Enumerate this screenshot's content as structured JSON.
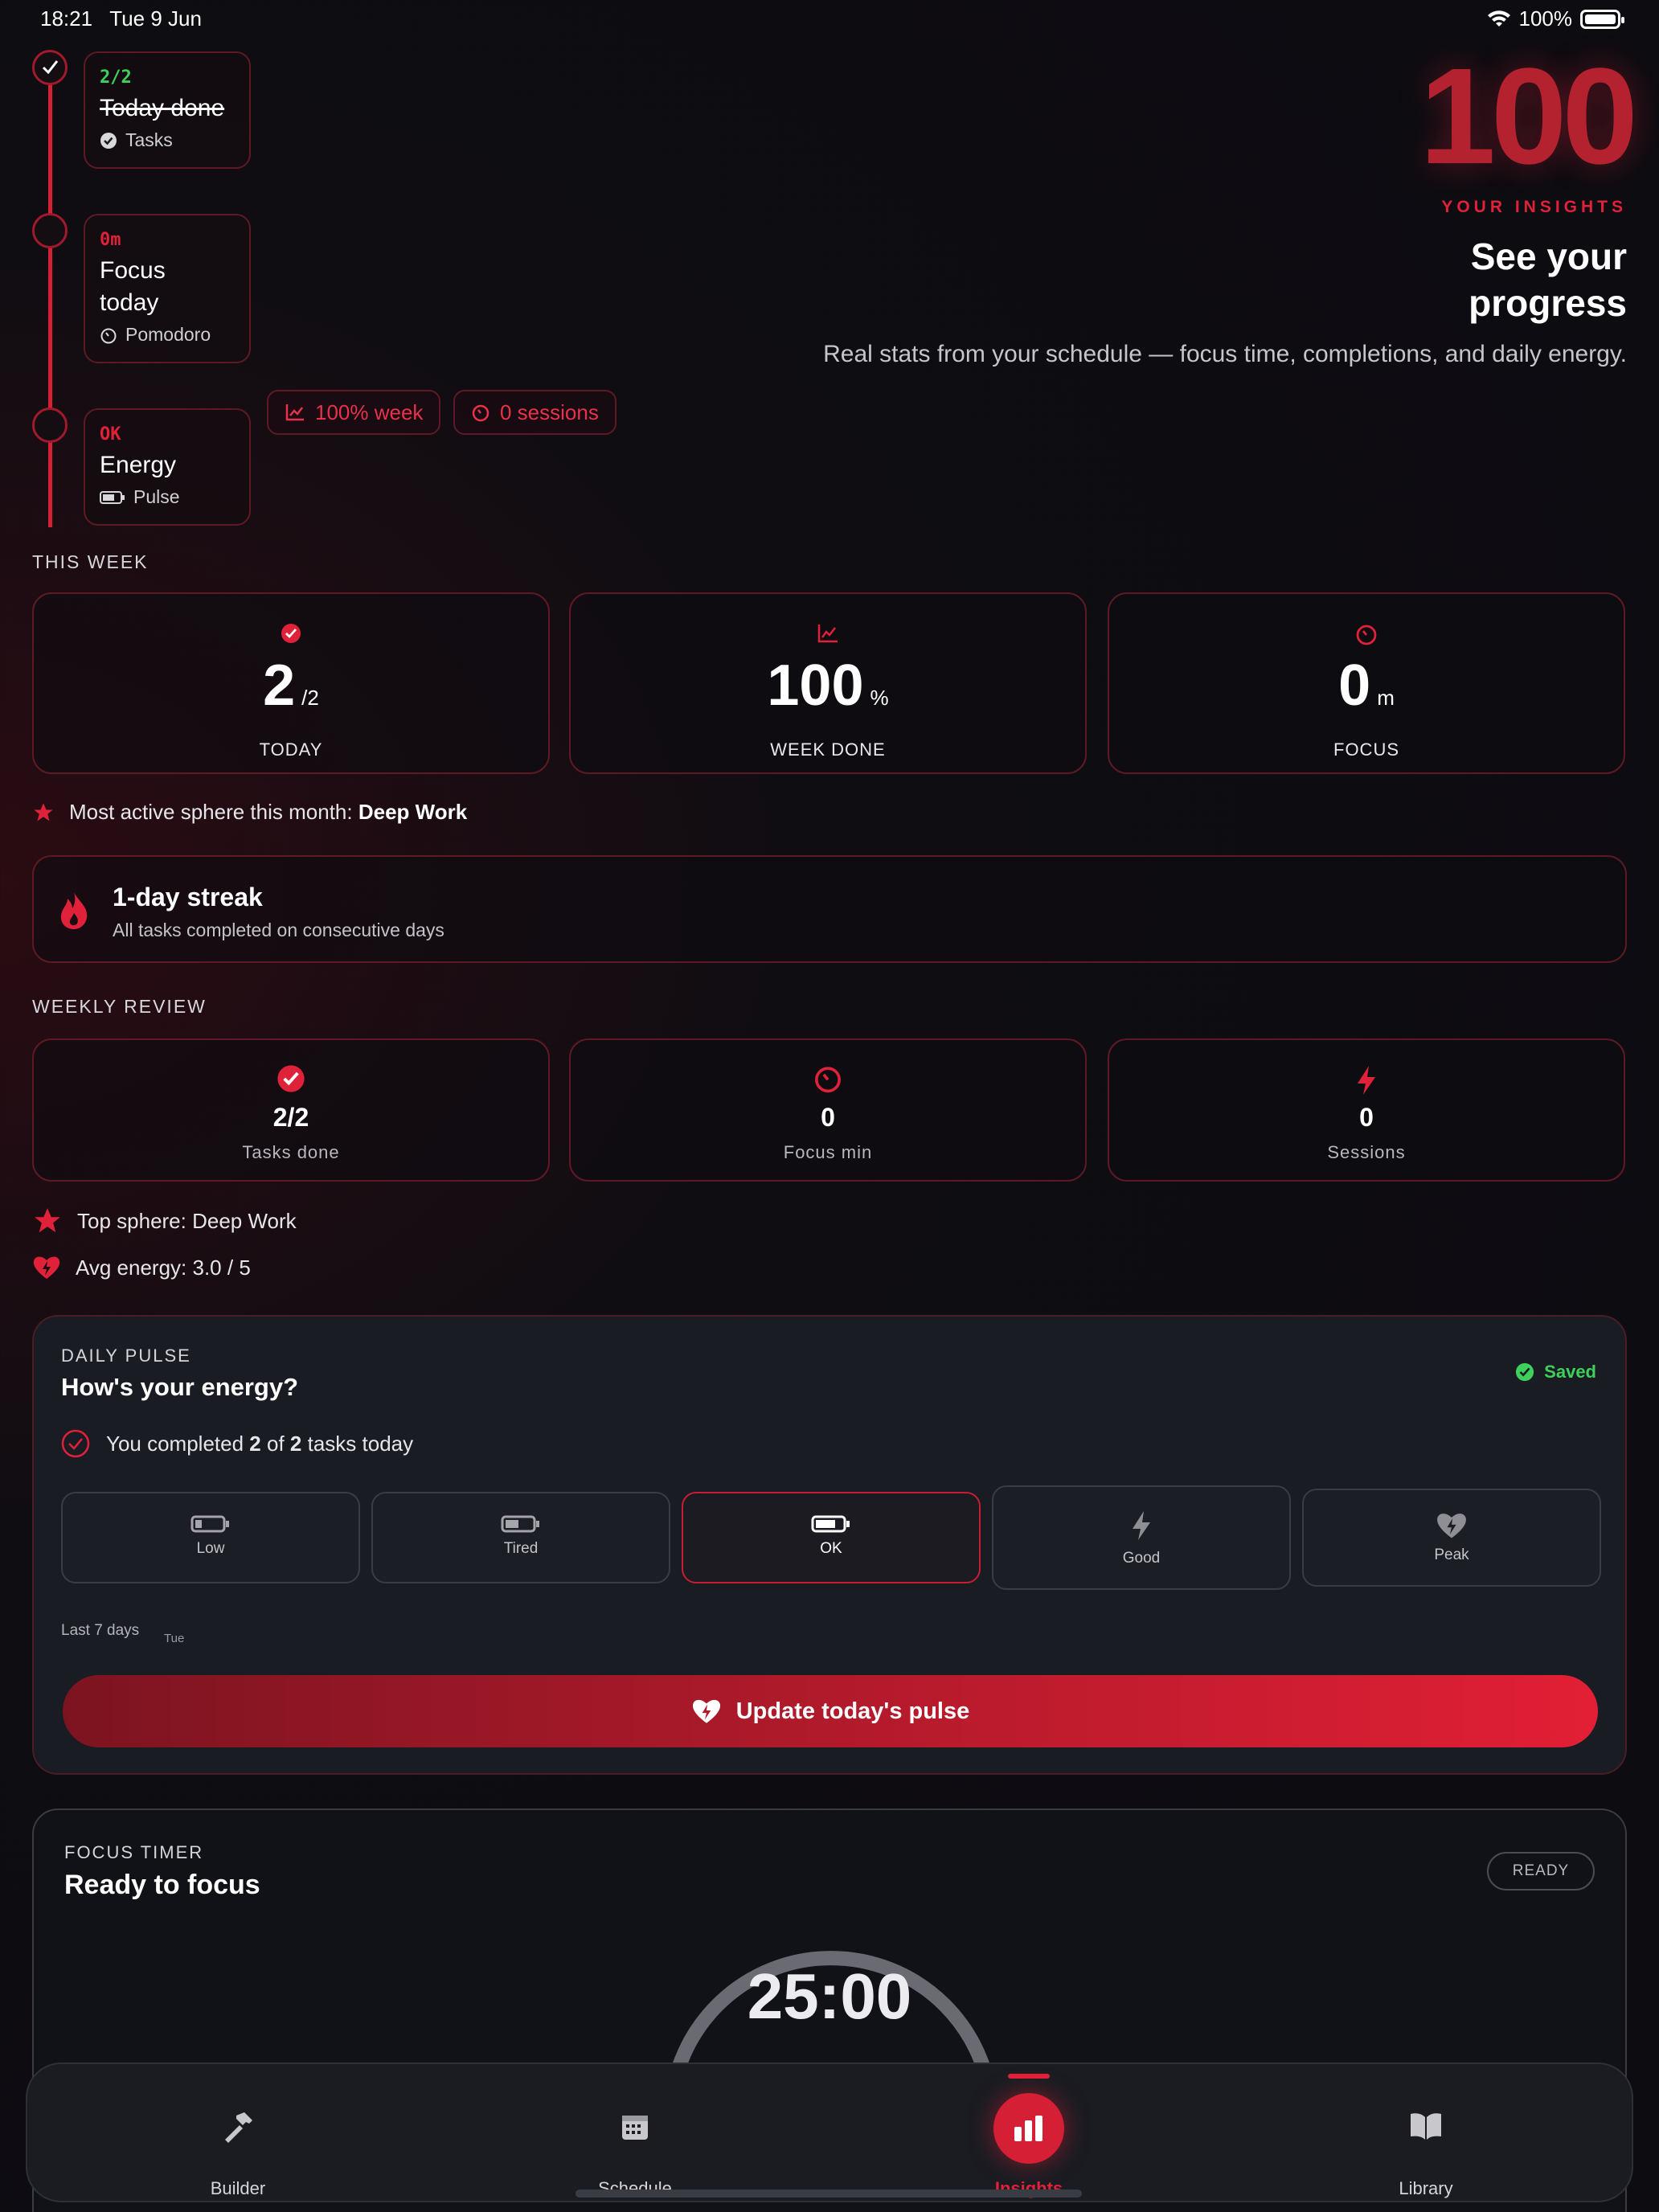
{
  "status_bar": {
    "time": "18:21",
    "date": "Tue 9 Jun",
    "battery": "100%"
  },
  "timeline": [
    {
      "tag": "2/2",
      "title": "Today done",
      "sub": "Tasks",
      "tag_color": "#3fcf5b"
    },
    {
      "tag": "0m",
      "title": "Focus today",
      "sub": "Pomodoro",
      "tag_color": "#e0213a"
    },
    {
      "tag": "OK",
      "title": "Energy",
      "sub": "Pulse",
      "tag_color": "#e0213a"
    }
  ],
  "pills": {
    "week": "100% week",
    "sessions": "0 sessions"
  },
  "hero": {
    "number": "100",
    "kicker": "YOUR INSIGHTS",
    "title_line1": "See your",
    "title_line2": "progress",
    "description": "Real stats from your schedule — focus time, completions, and daily energy."
  },
  "this_week": {
    "label": "THIS WEEK",
    "cards": [
      {
        "value": "2",
        "unit": "/2",
        "label": "TODAY",
        "icon": "check-circle-icon"
      },
      {
        "value": "100",
        "unit": "%",
        "label": "WEEK DONE",
        "icon": "trend-chart-icon"
      },
      {
        "value": "0",
        "unit": "m",
        "label": "FOCUS",
        "icon": "timer-icon"
      }
    ],
    "most_active_prefix": "Most active sphere this month:",
    "most_active_value": "Deep Work"
  },
  "streak": {
    "title": "1-day streak",
    "subtitle": "All tasks completed on consecutive days"
  },
  "weekly_review": {
    "label": "WEEKLY REVIEW",
    "cards": [
      {
        "value": "2/2",
        "label": "Tasks done",
        "icon": "check-circle-icon"
      },
      {
        "value": "0",
        "label": "Focus min",
        "icon": "timer-icon"
      },
      {
        "value": "0",
        "label": "Sessions",
        "icon": "bolt-icon"
      }
    ],
    "top_sphere": "Top sphere: Deep Work",
    "avg_energy": "Avg energy: 3.0 / 5"
  },
  "daily_pulse": {
    "label": "DAILY PULSE",
    "question": "How's your energy?",
    "saved": "Saved",
    "completed_prefix": "You completed",
    "completed_done": "2",
    "completed_mid": "of",
    "completed_total": "2",
    "completed_suffix": "tasks today",
    "options": [
      "Low",
      "Tired",
      "OK",
      "Good",
      "Peak"
    ],
    "selected": "OK",
    "last7_label": "Last 7 days",
    "last7_day": "Tue",
    "cta": "Update today's pulse"
  },
  "focus_timer": {
    "label": "FOCUS TIMER",
    "title": "Ready to focus",
    "badge": "READY",
    "time": "25:00"
  },
  "tabs": [
    {
      "label": "Builder",
      "icon": "hammer-icon"
    },
    {
      "label": "Schedule",
      "icon": "calendar-icon"
    },
    {
      "label": "Insights",
      "icon": "bar-chart-icon",
      "active": true
    },
    {
      "label": "Library",
      "icon": "book-icon"
    }
  ],
  "colors": {
    "accent": "#e0213a",
    "success": "#3fcf5b",
    "background": "#0c0c11"
  }
}
